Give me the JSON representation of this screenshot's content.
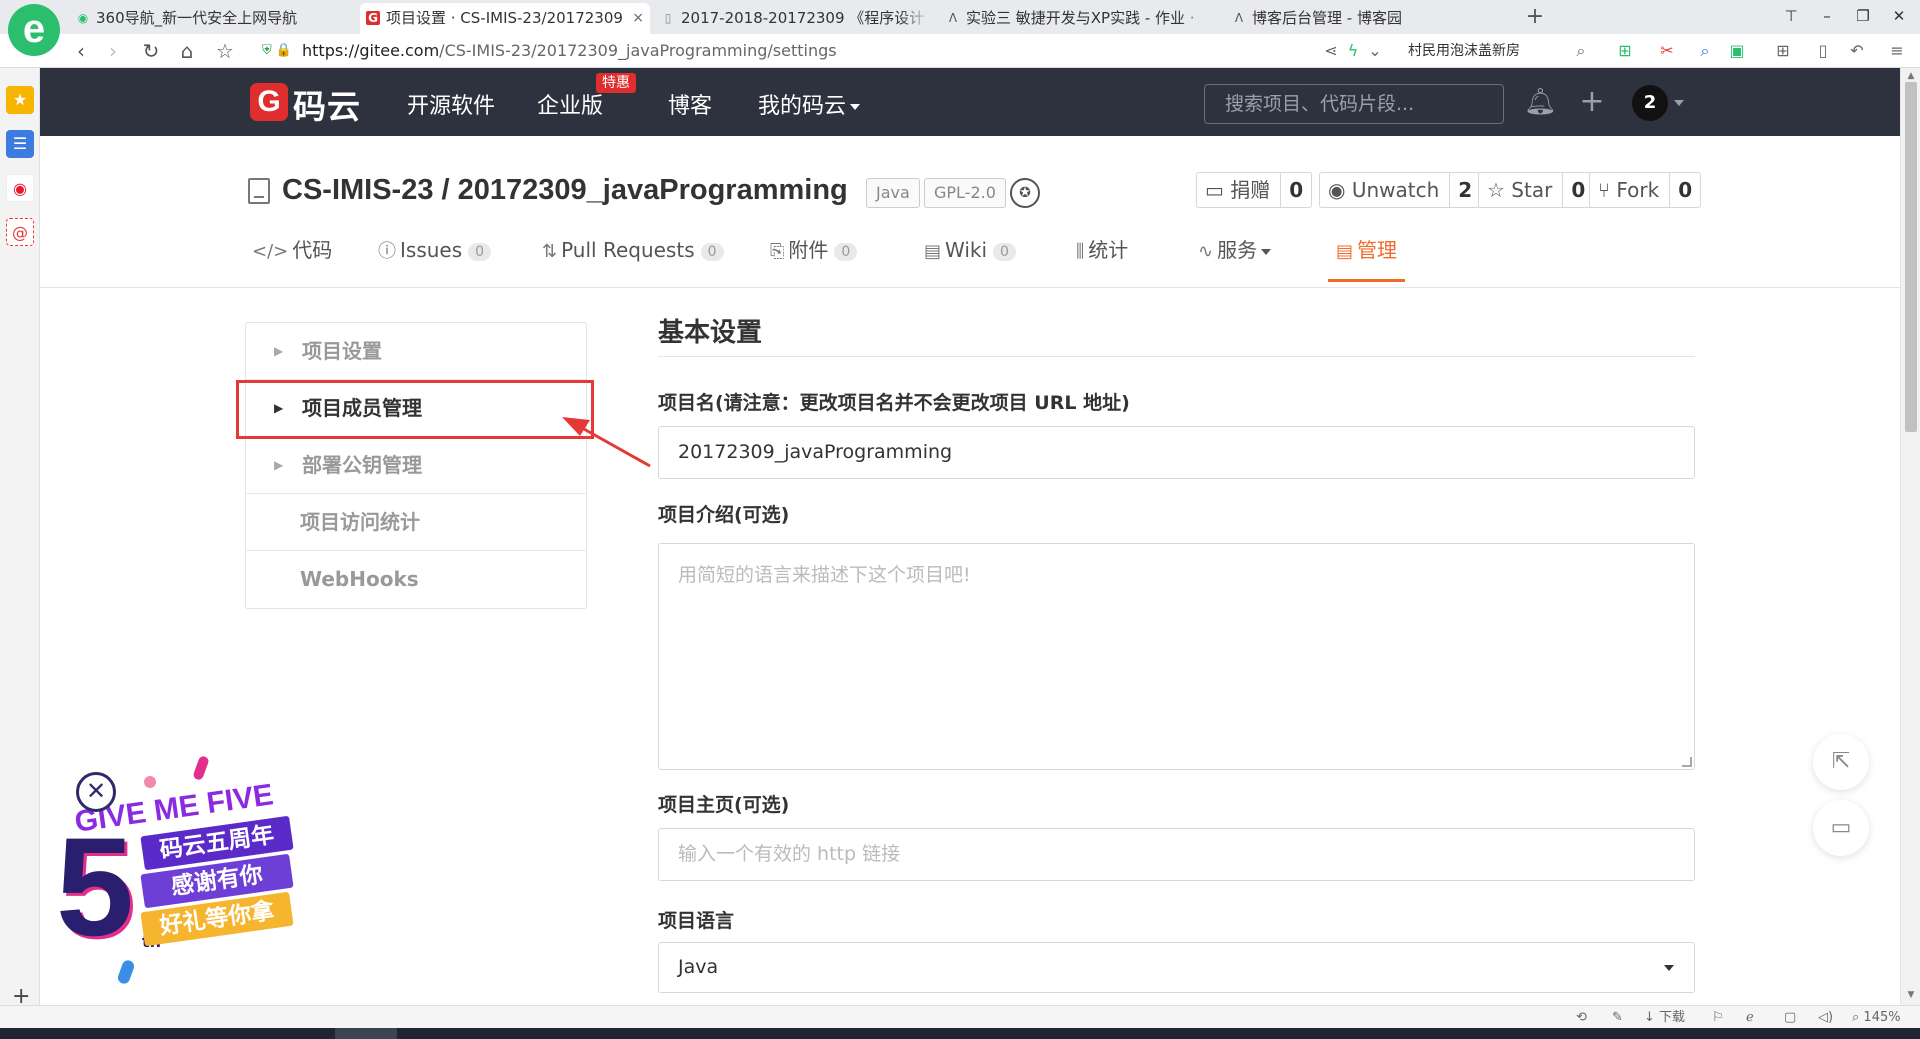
{
  "browser": {
    "tabs": [
      {
        "title": "360导航_新一代安全上网导航",
        "icon": "360-favicon"
      },
      {
        "title": "项目设置 · CS-IMIS-23/20172309",
        "icon": "gitee-favicon",
        "close": "×"
      },
      {
        "title": "2017-2018-20172309 《程序设计",
        "icon": "page-favicon"
      },
      {
        "title": "实验三 敏捷开发与XP实践 - 作业 ·",
        "icon": "cnblogs-favicon"
      },
      {
        "title": "博客后台管理 - 博客园",
        "icon": "cnblogs-favicon"
      }
    ],
    "new_tab": "+",
    "url_host": "https://gitee.com",
    "url_path": "/CS-IMIS-23/20172309_javaProgramming/settings",
    "search_hint": "村民用泡沫盖新房",
    "logo_letter": "e"
  },
  "header": {
    "logo_letter": "G",
    "logo_text": "码云",
    "nav": [
      "开源软件",
      "企业版",
      "博客",
      "我的码云"
    ],
    "hot_badge": "特惠",
    "search_placeholder": "搜索项目、代码片段...",
    "avatar_label": "2"
  },
  "repo": {
    "title": "CS-IMIS-23 / 20172309_javaProgramming",
    "tags": [
      "Java",
      "GPL-2.0"
    ],
    "actions": [
      {
        "label": "捐赠",
        "count": "0",
        "icon": "donate-icon"
      },
      {
        "label": "Unwatch",
        "count": "2",
        "icon": "eye-icon"
      },
      {
        "label": "Star",
        "count": "0",
        "icon": "star-icon"
      },
      {
        "label": "Fork",
        "count": "0",
        "icon": "fork-icon"
      }
    ],
    "tabs": [
      {
        "label": "代码",
        "icon": "code-icon"
      },
      {
        "label": "Issues",
        "count": "0",
        "icon": "issue-icon"
      },
      {
        "label": "Pull Requests",
        "count": "0",
        "icon": "pull-request-icon"
      },
      {
        "label": "附件",
        "count": "0",
        "icon": "attachment-icon"
      },
      {
        "label": "Wiki",
        "count": "0",
        "icon": "wiki-icon"
      },
      {
        "label": "统计",
        "icon": "stats-icon"
      },
      {
        "label": "服务",
        "icon": "service-icon"
      },
      {
        "label": "管理",
        "icon": "manage-icon",
        "active": true
      }
    ]
  },
  "menu": {
    "items": [
      "项目设置",
      "项目成员管理",
      "部署公钥管理",
      "项目访问统计",
      "WebHooks"
    ],
    "active_index": 1
  },
  "form": {
    "section_title": "基本设置",
    "name_label": "项目名(请注意：更改项目名并不会更改项目 URL 地址)",
    "name_value": "20172309_javaProgramming",
    "desc_label": "项目介绍(可选)",
    "desc_placeholder": "用简短的语言来描述下这个项目吧!",
    "homepage_label": "项目主页(可选)",
    "homepage_placeholder": "输入一个有效的 http 链接",
    "language_label": "项目语言",
    "language_value": "Java"
  },
  "promo": {
    "headline": "GIVE ME FIVE",
    "number": "5",
    "suffix": "th",
    "line1": "码云五周年",
    "line2": "感谢有你",
    "line3": "好礼等你拿"
  },
  "statusbar": {
    "download": "下载",
    "zoom": "145%"
  },
  "colors": {
    "accent": "#f06c2c",
    "header_bg": "#2e323e",
    "highlight": "#e53935"
  }
}
